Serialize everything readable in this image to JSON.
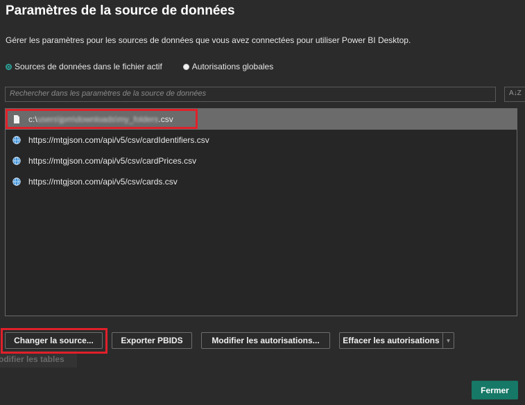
{
  "dialog": {
    "title": "Paramètres de la source de données",
    "description": "Gérer les paramètres pour les sources de données que vous avez connectées pour utiliser Power BI Desktop."
  },
  "scope": {
    "options": [
      {
        "label": "Sources de données dans le fichier actif",
        "checked": true
      },
      {
        "label": "Autorisations globales",
        "checked": false
      }
    ]
  },
  "search": {
    "placeholder": "Rechercher dans les paramètres de la source de données",
    "sort_label": "A↓Z"
  },
  "sources": [
    {
      "icon": "file-icon",
      "prefix": "c:\\",
      "blurred": "users\\jpm\\downloads\\my_folders",
      "suffix": ".csv",
      "selected": true
    },
    {
      "icon": "globe-icon",
      "text": "https://mtgjson.com/api/v5/csv/cardIdentifiers.csv",
      "selected": false
    },
    {
      "icon": "globe-icon",
      "text": "https://mtgjson.com/api/v5/csv/cardPrices.csv",
      "selected": false
    },
    {
      "icon": "globe-icon",
      "text": "https://mtgjson.com/api/v5/csv/cards.csv",
      "selected": false
    }
  ],
  "actions": {
    "change_source": "Changer la source...",
    "export_pbids": "Exporter PBIDS",
    "edit_permissions": "Modifier les autorisations...",
    "clear_permissions": "Effacer les autorisations",
    "edit_tables": "Modifier les tables"
  },
  "footer": {
    "close": "Fermer"
  },
  "colors": {
    "accent": "#167866",
    "highlight": "#e0202a",
    "selected_row": "#6b6b6b"
  }
}
